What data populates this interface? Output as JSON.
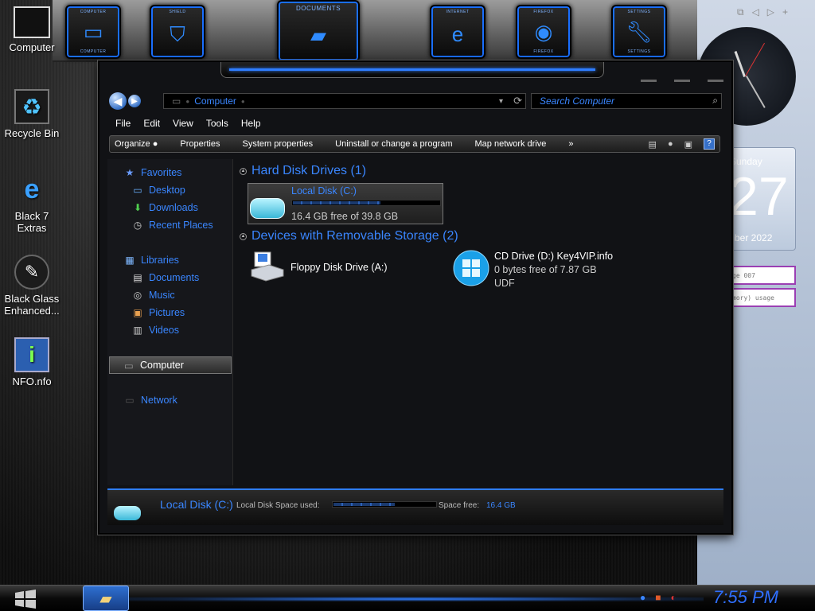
{
  "dock": {
    "items": [
      {
        "top_label": "COMPUTER",
        "bottom_label": "COMPUTER",
        "icon": "monitor-icon"
      },
      {
        "top_label": "SHIELD",
        "bottom_label": "",
        "icon": "shield-icon"
      },
      {
        "top_label": "DOCUMENTS",
        "bottom_label": "",
        "icon": "folder-icon"
      },
      {
        "top_label": "INTERNET",
        "bottom_label": "",
        "icon": "ie-icon"
      },
      {
        "top_label": "FIREFOX",
        "bottom_label": "FIREFOX",
        "icon": "firefox-icon"
      },
      {
        "top_label": "SETTINGS",
        "bottom_label": "SETTINGS",
        "icon": "wrench-icon"
      }
    ]
  },
  "desktop": {
    "icons": [
      {
        "label": "Computer",
        "icon": "computer-icon"
      },
      {
        "label": "Recycle Bin",
        "icon": "recycle-bin-icon"
      },
      {
        "label": "Black 7 Extras",
        "icon": "ie-icon"
      },
      {
        "label": "Black Glass Enhanced...",
        "icon": "brush-icon"
      },
      {
        "label": "NFO.nfo",
        "icon": "info-icon"
      }
    ]
  },
  "gadgets": {
    "calendar": {
      "day": "Sunday",
      "date": "27",
      "month": "mber 2022"
    },
    "meters": [
      "ge 007",
      "mory) usage"
    ]
  },
  "window": {
    "address": {
      "location": "Computer"
    },
    "search": {
      "placeholder": "Search Computer"
    },
    "menu": [
      "File",
      "Edit",
      "View",
      "Tools",
      "Help"
    ],
    "toolbar": [
      "Organize",
      "Properties",
      "System properties",
      "Uninstall or change a program",
      "Map network drive",
      "»"
    ],
    "nav": {
      "favorites": "Favorites",
      "desktop": "Desktop",
      "downloads": "Downloads",
      "recent": "Recent Places",
      "libraries": "Libraries",
      "documents": "Documents",
      "music": "Music",
      "pictures": "Pictures",
      "videos": "Videos",
      "computer": "Computer",
      "network": "Network"
    },
    "groups": {
      "hdd": "Hard Disk Drives (1)",
      "removable": "Devices with Removable Storage (2)"
    },
    "local_disk": {
      "name": "Local Disk (C:)",
      "free_text": "16.4 GB free of 39.8 GB",
      "used_fraction": 0.59
    },
    "floppy": {
      "name": "Floppy Disk Drive (A:)"
    },
    "cd": {
      "name": "CD Drive (D:) Key4VIP.info",
      "free_text": "0 bytes free of 7.87 GB",
      "fs": "UDF"
    },
    "details": {
      "name": "Local Disk (C:)",
      "space_used_label": "Local Disk Space used:",
      "space_free_label": "Space free:",
      "space_free_value": "16.4 GB"
    }
  },
  "taskbar": {
    "time": "7:55 PM"
  },
  "colors": {
    "accent": "#3a86ff",
    "window_bg": "#111215"
  }
}
